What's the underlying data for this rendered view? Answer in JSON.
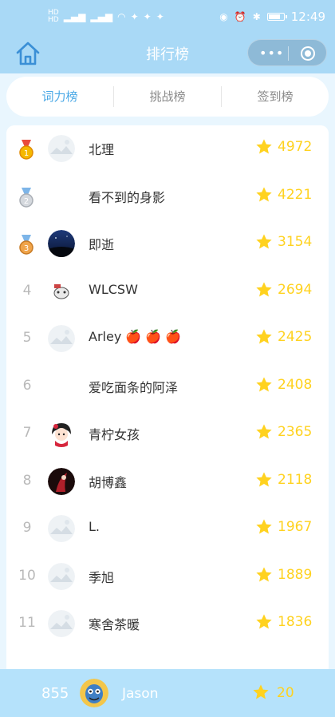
{
  "status_bar": {
    "time": "12:49",
    "left_icons": [
      "hd-signal-icon",
      "signal-icon",
      "signal-icon",
      "wifi-icon",
      "notification-icon",
      "notification-icon",
      "notification-icon"
    ],
    "right_icons": [
      "eye-icon",
      "alarm-icon",
      "bluetooth-icon",
      "battery-icon"
    ]
  },
  "navbar": {
    "title": "排行榜"
  },
  "tabs": [
    {
      "label": "词力榜",
      "active": true
    },
    {
      "label": "挑战榜",
      "active": false
    },
    {
      "label": "签到榜",
      "active": false
    }
  ],
  "leaderboard": [
    {
      "rank": "1",
      "medal": "gold",
      "name": "北理",
      "score": "4972",
      "avatar": "default"
    },
    {
      "rank": "2",
      "medal": "silver",
      "name": "看不到的身影",
      "score": "4221",
      "avatar": "none"
    },
    {
      "rank": "3",
      "medal": "bronze",
      "name": "即逝",
      "score": "3154",
      "avatar": "night"
    },
    {
      "rank": "4",
      "name": "WLCSW",
      "score": "2694",
      "avatar": "sticker"
    },
    {
      "rank": "5",
      "name": "Arley 🍎 🍎 🍎",
      "score": "2425",
      "avatar": "default"
    },
    {
      "rank": "6",
      "name": "爱吃面条的阿泽",
      "score": "2408",
      "avatar": "none"
    },
    {
      "rank": "7",
      "name": "青柠女孩",
      "score": "2365",
      "avatar": "girl"
    },
    {
      "rank": "8",
      "name": "胡博鑫",
      "score": "2118",
      "avatar": "dark"
    },
    {
      "rank": "9",
      "name": "L.",
      "score": "1967",
      "avatar": "default"
    },
    {
      "rank": "10",
      "name": "季旭",
      "score": "1889",
      "avatar": "default"
    },
    {
      "rank": "11",
      "name": "寒舍茶暖",
      "score": "1836",
      "avatar": "default"
    }
  ],
  "me": {
    "rank": "855",
    "name": "Jason",
    "score": "20"
  },
  "colors": {
    "header_bg": "#a9d9f6",
    "active_tab": "#4aa8e6",
    "score": "#ffd21f",
    "bottom_bar": "#b5e2fb"
  }
}
